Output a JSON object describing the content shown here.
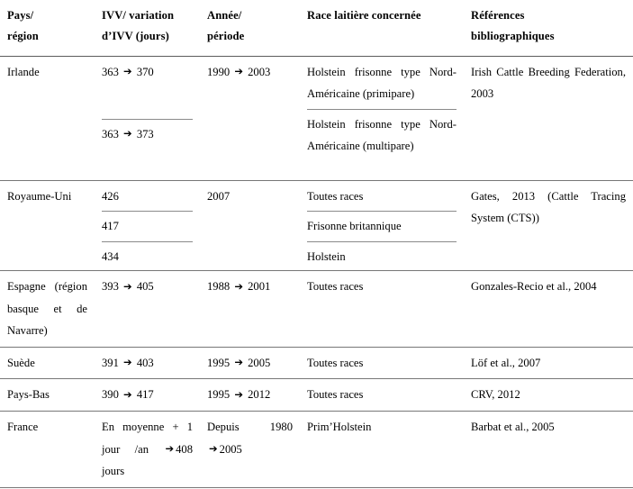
{
  "table": {
    "caption": "",
    "arrow_glyph": "➔",
    "columns": [
      {
        "id": "pays_region",
        "label_line1": "Pays/",
        "label_line2": "région"
      },
      {
        "id": "ivv",
        "label_line1": "IVV/ variation",
        "label_line2": "d’IVV (jours)"
      },
      {
        "id": "annee_periode",
        "label_line1": "Année/",
        "label_line2": "période"
      },
      {
        "id": "race",
        "label_line1": "Race laitière concernée",
        "label_line2": ""
      },
      {
        "id": "references",
        "label_line1": "Références",
        "label_line2": "bibliographiques"
      }
    ],
    "rows": [
      {
        "pays_region": "Irlande",
        "ivv_parts": [
          "363 ➔ 370",
          "363 ➔ 373"
        ],
        "annee_periode": "1990 ➔ 2003",
        "race_parts": [
          "Holstein frisonne type Nord-Américaine (primipare)",
          "Holstein frisonne type Nord-Américaine (multipare)"
        ],
        "references": "Irish Cattle Breeding Federation, 2003"
      },
      {
        "pays_region": "Royaume-Uni",
        "ivv_parts": [
          "426",
          "417",
          "434"
        ],
        "annee_periode": "2007",
        "race_parts": [
          "Toutes races",
          "Frisonne britannique",
          "Holstein"
        ],
        "references": "Gates, 2013 (Cattle Tracing System (CTS))"
      },
      {
        "pays_region": "Espagne (région basque et de Navarre)",
        "ivv_parts": [
          "393 ➔ 405"
        ],
        "annee_periode": "1988 ➔ 2001",
        "race_parts": [
          "Toutes races"
        ],
        "references": "Gonzales-Recio et al., 2004"
      },
      {
        "pays_region": "Suède",
        "ivv_parts": [
          "391 ➔ 403"
        ],
        "annee_periode": "1995 ➔ 2005",
        "race_parts": [
          "Toutes races"
        ],
        "references": "Löf et al., 2007"
      },
      {
        "pays_region": "Pays-Bas",
        "ivv_parts": [
          "390 ➔ 417"
        ],
        "annee_periode": "1995 ➔ 2012",
        "race_parts": [
          "Toutes races"
        ],
        "references": "CRV, 2012"
      },
      {
        "pays_region": "France",
        "ivv_parts": [
          "En moyenne + 1 jour /an ➔408 jours"
        ],
        "annee_periode": "Depuis 1980 ➔2005",
        "race_parts": [
          "Prim’Holstein"
        ],
        "references": "Barbat et al., 2005"
      }
    ]
  }
}
